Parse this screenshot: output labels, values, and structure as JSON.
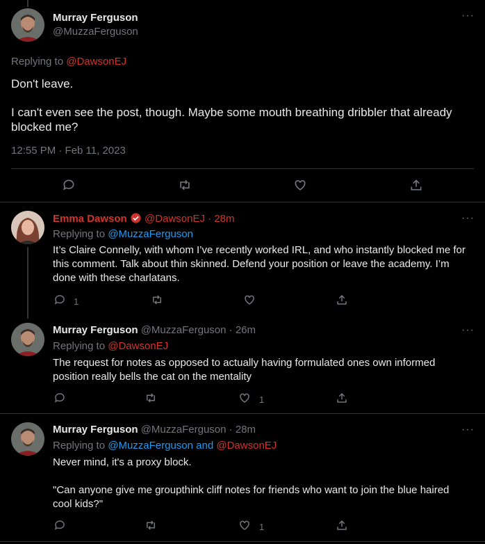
{
  "main_tweet": {
    "author_name": "Murray Ferguson",
    "author_handle": "@MuzzaFerguson",
    "replying_prefix": "Replying to",
    "replying_to": "@DawsonEJ",
    "line1": "Don't leave.",
    "line2": "I can't even see the post, though. Maybe some mouth breathing dribbler that already blocked me?",
    "timestamp": "12:55 PM · Feb 11, 2023",
    "more": "···"
  },
  "replies": [
    {
      "author_name": "Emma Dawson",
      "verified": true,
      "author_handle": "@DawsonEJ",
      "time": "· 28m",
      "replying_prefix": "Replying to",
      "replying_to": "@MuzzaFerguson",
      "text": "It’s Claire Connelly, with whom I’ve recently worked IRL, and who instantly blocked me for this comment. Talk about thin skinned. Defend your position or leave the academy. I’m done with these charlatans.",
      "reply_count": "1",
      "retweet_count": "",
      "like_count": "",
      "more": "···"
    },
    {
      "author_name": "Murray Ferguson",
      "author_handle": "@MuzzaFerguson",
      "time": "· 26m",
      "replying_prefix": "Replying to",
      "replying_to": "@DawsonEJ",
      "text": "The request for notes as opposed to actually having formulated ones own informed position really bells the cat on the mentality",
      "reply_count": "",
      "retweet_count": "",
      "like_count": "1",
      "more": "···"
    },
    {
      "author_name": "Murray Ferguson",
      "author_handle": "@MuzzaFerguson",
      "time": "· 28m",
      "replying_prefix": "Replying to",
      "replying_to_1": "@MuzzaFerguson",
      "replying_and": "and",
      "replying_to_2": "@DawsonEJ",
      "line1": "Never mind, it's a proxy block.",
      "line2": "\"Can anyone give me groupthink cliff notes for friends who want to join the blue haired cool kids?\"",
      "reply_count": "",
      "retweet_count": "",
      "like_count": "1",
      "more": "···"
    }
  ],
  "colors": {
    "background": "#000000",
    "text": "#e7e9ea",
    "muted": "#71767b",
    "mention_red": "#d1332c",
    "mention_blue": "#1d9bf0",
    "divider": "#2f3336"
  },
  "icons": [
    "reply-icon",
    "retweet-icon",
    "like-icon",
    "share-icon",
    "more-icon",
    "verified-badge-icon"
  ]
}
